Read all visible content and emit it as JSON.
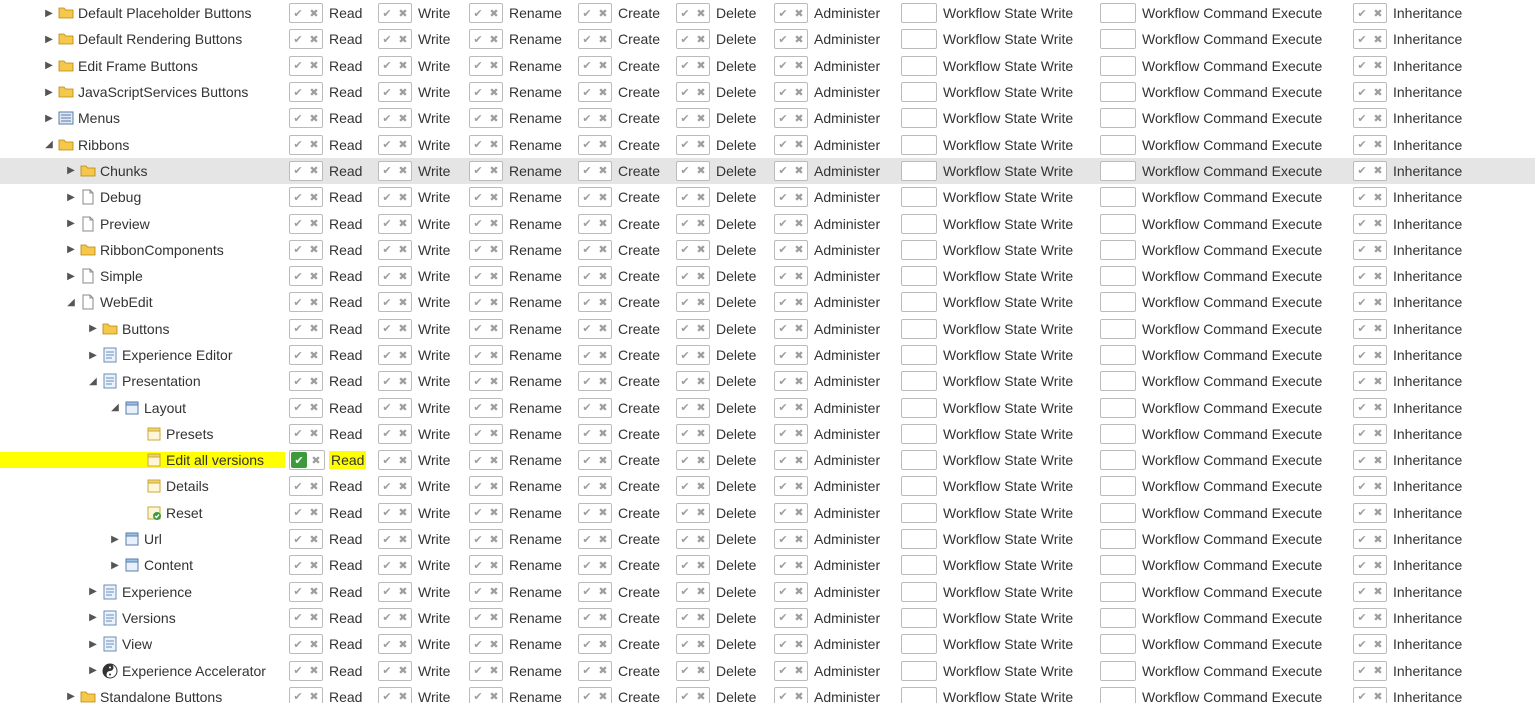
{
  "permissions": [
    {
      "key": "read",
      "label": "Read",
      "cls": "col-read",
      "boxStyle": "cx"
    },
    {
      "key": "write",
      "label": "Write",
      "cls": "col-write",
      "boxStyle": "cx"
    },
    {
      "key": "rename",
      "label": "Rename",
      "cls": "col-rename",
      "boxStyle": "cx"
    },
    {
      "key": "create",
      "label": "Create",
      "cls": "col-create",
      "boxStyle": "cx"
    },
    {
      "key": "delete",
      "label": "Delete",
      "cls": "col-delete",
      "boxStyle": "cx"
    },
    {
      "key": "administer",
      "label": "Administer",
      "cls": "col-admin",
      "boxStyle": "cx"
    },
    {
      "key": "wsw",
      "label": "Workflow State Write",
      "cls": "col-wsw",
      "boxStyle": "empty"
    },
    {
      "key": "wce",
      "label": "Workflow Command Execute",
      "cls": "col-wce",
      "boxStyle": "empty"
    },
    {
      "key": "inh",
      "label": "Inheritance",
      "cls": "col-inh",
      "boxStyle": "cx"
    }
  ],
  "tree": [
    {
      "depth": 1,
      "toggle": "right",
      "icon": "folder",
      "label": "Default Placeholder Buttons"
    },
    {
      "depth": 1,
      "toggle": "right",
      "icon": "folder",
      "label": "Default Rendering Buttons"
    },
    {
      "depth": 1,
      "toggle": "right",
      "icon": "folder",
      "label": "Edit Frame Buttons"
    },
    {
      "depth": 1,
      "toggle": "right",
      "icon": "folder",
      "label": "JavaScriptServices Buttons"
    },
    {
      "depth": 1,
      "toggle": "right",
      "icon": "menus",
      "label": "Menus"
    },
    {
      "depth": 1,
      "toggle": "down",
      "icon": "folder",
      "label": "Ribbons"
    },
    {
      "depth": 2,
      "toggle": "right",
      "icon": "folder",
      "label": "Chunks",
      "selected": true
    },
    {
      "depth": 2,
      "toggle": "right",
      "icon": "doc",
      "label": "Debug"
    },
    {
      "depth": 2,
      "toggle": "right",
      "icon": "doc",
      "label": "Preview"
    },
    {
      "depth": 2,
      "toggle": "right",
      "icon": "folder",
      "label": "RibbonComponents"
    },
    {
      "depth": 2,
      "toggle": "right",
      "icon": "doc",
      "label": "Simple"
    },
    {
      "depth": 2,
      "toggle": "down",
      "icon": "doc",
      "label": "WebEdit"
    },
    {
      "depth": 3,
      "toggle": "right",
      "icon": "folder",
      "label": "Buttons"
    },
    {
      "depth": 3,
      "toggle": "right",
      "icon": "page",
      "label": "Experience Editor"
    },
    {
      "depth": 3,
      "toggle": "down",
      "icon": "page",
      "label": "Presentation"
    },
    {
      "depth": 4,
      "toggle": "down",
      "icon": "layout",
      "label": "Layout"
    },
    {
      "depth": 5,
      "toggle": "none",
      "icon": "presets",
      "label": "Presets"
    },
    {
      "depth": 5,
      "toggle": "none",
      "icon": "presets",
      "label": "Edit all versions",
      "highlighted": true,
      "readChecked": true
    },
    {
      "depth": 5,
      "toggle": "none",
      "icon": "presets",
      "label": "Details"
    },
    {
      "depth": 5,
      "toggle": "none",
      "icon": "reset",
      "label": "Reset"
    },
    {
      "depth": 4,
      "toggle": "right",
      "icon": "layout",
      "label": "Url"
    },
    {
      "depth": 4,
      "toggle": "right",
      "icon": "layout",
      "label": "Content"
    },
    {
      "depth": 3,
      "toggle": "right",
      "icon": "page",
      "label": "Experience"
    },
    {
      "depth": 3,
      "toggle": "right",
      "icon": "page",
      "label": "Versions"
    },
    {
      "depth": 3,
      "toggle": "right",
      "icon": "page",
      "label": "View"
    },
    {
      "depth": 3,
      "toggle": "right",
      "icon": "yinyang",
      "label": "Experience Accelerator"
    },
    {
      "depth": 2,
      "toggle": "right",
      "icon": "folder",
      "label": "Standalone Buttons"
    }
  ]
}
